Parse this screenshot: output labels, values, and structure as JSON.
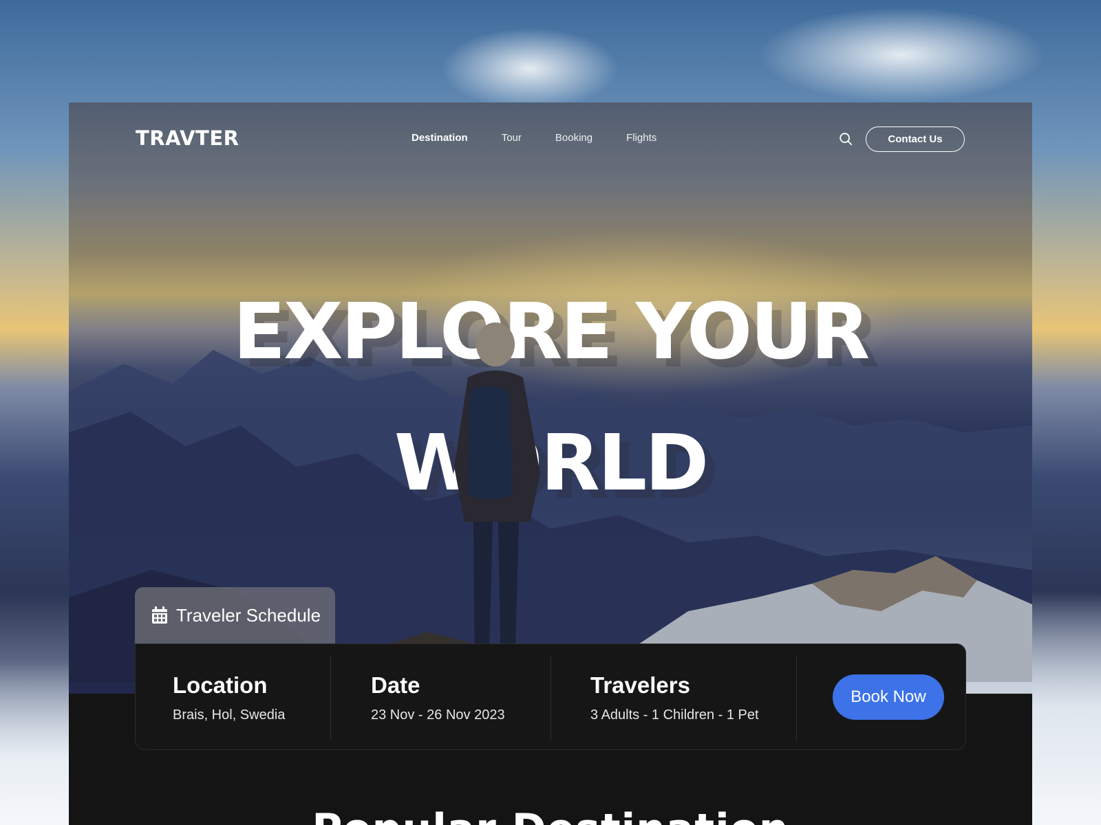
{
  "brand": {
    "logo": "TRAVTER"
  },
  "nav": {
    "links": [
      {
        "label": "Destination",
        "active": true
      },
      {
        "label": "Tour",
        "active": false
      },
      {
        "label": "Booking",
        "active": false
      },
      {
        "label": "Flights",
        "active": false
      }
    ],
    "search_icon": "search-icon",
    "contact_label": "Contact Us"
  },
  "hero": {
    "headline_line1": "EXPLORE YOUR",
    "headline_line2": "WORLD"
  },
  "schedule": {
    "tab_label": "Traveler Schedule",
    "tab_icon": "calendar-icon",
    "fields": [
      {
        "title": "Location",
        "value": "Brais, Hol, Swedia"
      },
      {
        "title": "Date",
        "value": "23 Nov - 26 Nov 2023"
      },
      {
        "title": "Travelers",
        "value": "3 Adults - 1 Children - 1 Pet"
      }
    ],
    "book_label": "Book Now"
  },
  "section": {
    "heading_partial": "Popular Destination"
  },
  "colors": {
    "accent": "#3D72E8",
    "card_background": "#161616",
    "page_dark": "#141414",
    "text": "#FFFFFF"
  }
}
